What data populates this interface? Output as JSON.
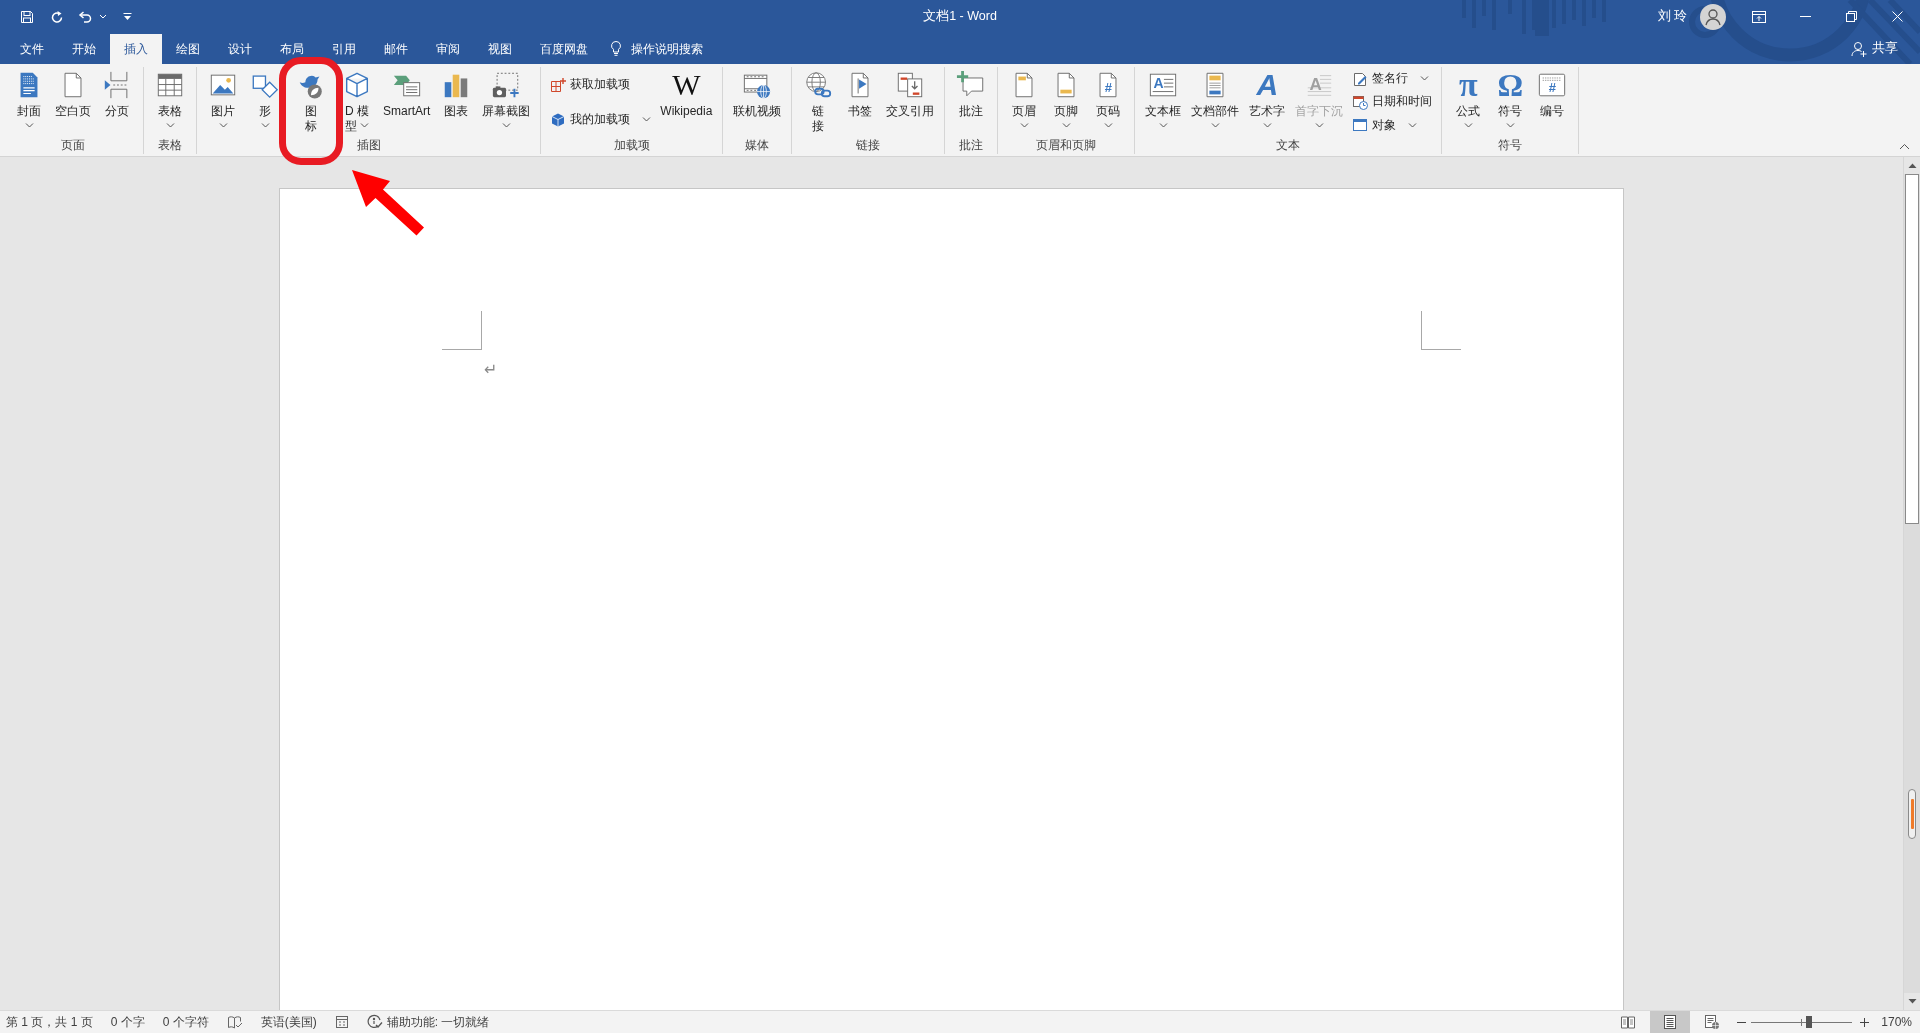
{
  "window": {
    "title": "文档1 - Word",
    "user": "刘 玲"
  },
  "tabs": [
    {
      "label": "文件",
      "selected": false
    },
    {
      "label": "开始",
      "selected": false
    },
    {
      "label": "插入",
      "selected": true
    },
    {
      "label": "绘图",
      "selected": false
    },
    {
      "label": "设计",
      "selected": false
    },
    {
      "label": "布局",
      "selected": false
    },
    {
      "label": "引用",
      "selected": false
    },
    {
      "label": "邮件",
      "selected": false
    },
    {
      "label": "审阅",
      "selected": false
    },
    {
      "label": "视图",
      "selected": false
    },
    {
      "label": "百度网盘",
      "selected": false
    }
  ],
  "tell_me": {
    "placeholder": "操作说明搜索"
  },
  "share": {
    "label": "共享"
  },
  "ribbon": {
    "groups": [
      {
        "label": "页面",
        "items": [
          {
            "kind": "large",
            "label": "封面",
            "dropdown": true,
            "disabled": false,
            "highlighted": false
          },
          {
            "kind": "large",
            "label": "空白页",
            "dropdown": false,
            "disabled": false,
            "highlighted": false
          },
          {
            "kind": "large",
            "label": "分页",
            "dropdown": false,
            "disabled": false,
            "highlighted": false
          }
        ]
      },
      {
        "label": "表格",
        "items": [
          {
            "kind": "large",
            "label": "表格",
            "dropdown": true,
            "disabled": false,
            "highlighted": false
          }
        ]
      },
      {
        "label": "插图",
        "items": [
          {
            "kind": "large",
            "label": "图片",
            "dropdown": true,
            "disabled": false,
            "highlighted": false
          },
          {
            "kind": "large",
            "label": "形",
            "dropdown": true,
            "disabled": false,
            "highlighted": false
          },
          {
            "kind": "narrow",
            "label": "图标",
            "dropdown": false,
            "disabled": false,
            "highlighted": true
          },
          {
            "kind": "narrow",
            "label": "D 模型",
            "dropdown": true,
            "disabled": false,
            "highlighted": false
          },
          {
            "kind": "large",
            "label": "SmartArt",
            "dropdown": false,
            "disabled": false,
            "highlighted": false
          },
          {
            "kind": "large",
            "label": "图表",
            "dropdown": false,
            "disabled": false,
            "highlighted": false
          },
          {
            "kind": "large",
            "label": "屏幕截图",
            "dropdown": true,
            "disabled": false,
            "highlighted": false
          }
        ]
      },
      {
        "label": "加载项",
        "items": [
          {
            "kind": "small",
            "label": "获取加载项",
            "dropdown": false,
            "disabled": false,
            "highlighted": false
          },
          {
            "kind": "small",
            "label": "我的加载项",
            "dropdown": true,
            "disabled": false,
            "highlighted": false
          },
          {
            "kind": "large",
            "label": "Wikipedia",
            "glyph": "W",
            "dropdown": false,
            "disabled": false,
            "highlighted": false
          }
        ]
      },
      {
        "label": "媒体",
        "items": [
          {
            "kind": "large",
            "label": "联机视频",
            "dropdown": false,
            "disabled": false,
            "highlighted": false
          }
        ]
      },
      {
        "label": "链接",
        "items": [
          {
            "kind": "narrow",
            "label": "链接",
            "dropdown": false,
            "disabled": false,
            "highlighted": false
          },
          {
            "kind": "large",
            "label": "书签",
            "dropdown": false,
            "disabled": false,
            "highlighted": false
          },
          {
            "kind": "large",
            "label": "交叉引用",
            "dropdown": false,
            "disabled": false,
            "highlighted": false
          }
        ]
      },
      {
        "label": "批注",
        "items": [
          {
            "kind": "large",
            "label": "批注",
            "dropdown": false,
            "disabled": false,
            "highlighted": false
          }
        ]
      },
      {
        "label": "页眉和页脚",
        "items": [
          {
            "kind": "large",
            "label": "页眉",
            "dropdown": true,
            "disabled": false,
            "highlighted": false
          },
          {
            "kind": "large",
            "label": "页脚",
            "dropdown": true,
            "disabled": false,
            "highlighted": false
          },
          {
            "kind": "large",
            "label": "页码",
            "glyph": "#",
            "dropdown": true,
            "disabled": false,
            "highlighted": false
          }
        ]
      },
      {
        "label": "文本",
        "items": [
          {
            "kind": "large",
            "label": "文本框",
            "glyph": "A",
            "dropdown": true,
            "disabled": false,
            "highlighted": false
          },
          {
            "kind": "large",
            "label": "文档部件",
            "dropdown": true,
            "disabled": false,
            "highlighted": false
          },
          {
            "kind": "large",
            "label": "艺术字",
            "glyph": "A",
            "dropdown": true,
            "disabled": false,
            "highlighted": false
          },
          {
            "kind": "large",
            "label": "首字下沉",
            "glyph": "A",
            "dropdown": true,
            "disabled": true,
            "highlighted": false
          },
          {
            "kind": "small",
            "label": "签名行",
            "dropdown": true,
            "disabled": false,
            "highlighted": false
          },
          {
            "kind": "small",
            "label": "日期和时间",
            "dropdown": false,
            "disabled": false,
            "highlighted": false
          },
          {
            "kind": "small",
            "label": "对象",
            "dropdown": true,
            "disabled": false,
            "highlighted": false
          }
        ]
      },
      {
        "label": "符号",
        "items": [
          {
            "kind": "large",
            "label": "公式",
            "glyph": "π",
            "dropdown": true,
            "disabled": false,
            "highlighted": false
          },
          {
            "kind": "large",
            "label": "符号",
            "glyph": "Ω",
            "dropdown": true,
            "disabled": false,
            "highlighted": false
          },
          {
            "kind": "large",
            "label": "编号",
            "glyph": "#",
            "dropdown": false,
            "disabled": false,
            "highlighted": false
          }
        ]
      }
    ]
  },
  "document": {
    "paragraph_mark": "↵"
  },
  "status_bar": {
    "page": "第 1 页，共 1 页",
    "words": "0 个字",
    "characters": "0 个字符",
    "language": "英语(美国)",
    "accessibility": "辅助功能: 一切就绪",
    "views": [
      {
        "selected": false
      },
      {
        "selected": true
      },
      {
        "selected": false
      }
    ],
    "zoom": {
      "level": 0.57,
      "percent": "170%"
    }
  }
}
